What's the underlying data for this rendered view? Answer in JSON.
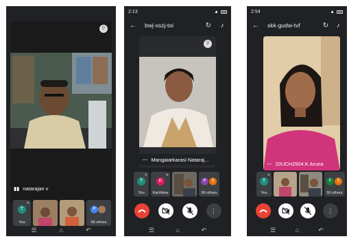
{
  "phone1": {
    "speaker_name": "natarajan v",
    "tiles": {
      "you_initial": "T",
      "you_label": "You",
      "others_initial": "P",
      "others_label": "96 others"
    }
  },
  "phone2": {
    "time": "2:13",
    "meeting_code": "bwj-xszj-toi",
    "speaker_name": "Mangaiarkarasi Nataraj...",
    "tiles": {
      "you_initial": "T",
      "you_label": "You",
      "k_initial": "K",
      "k_label": "Karthikas",
      "others_initial1": "P",
      "others_initial2": "S",
      "others_label": "96 others"
    }
  },
  "phone3": {
    "time": "2:54",
    "meeting_code": "skk-gudw-tvf",
    "speaker_name": "20UCH2504.K Aruna",
    "tiles": {
      "you_initial": "T",
      "you_label": "You",
      "others_initial1": "F",
      "others_initial2": "S",
      "others_label": "95 others"
    }
  },
  "colors": {
    "hangup": "#ea4335",
    "avatar_teal": "#1e8e7e",
    "avatar_pink": "#d81b60",
    "avatar_blue": "#4285f4",
    "avatar_purple": "#8e44ad",
    "avatar_orange": "#e8710a",
    "avatar_green": "#188038"
  },
  "icons": [
    "pin-icon",
    "mic-icon",
    "back-icon",
    "switch-camera-icon",
    "speaker-icon",
    "hangup-icon",
    "camera-off-icon",
    "mic-off-icon",
    "more-icon",
    "menu-nav-icon",
    "home-nav-icon",
    "back-nav-icon"
  ]
}
